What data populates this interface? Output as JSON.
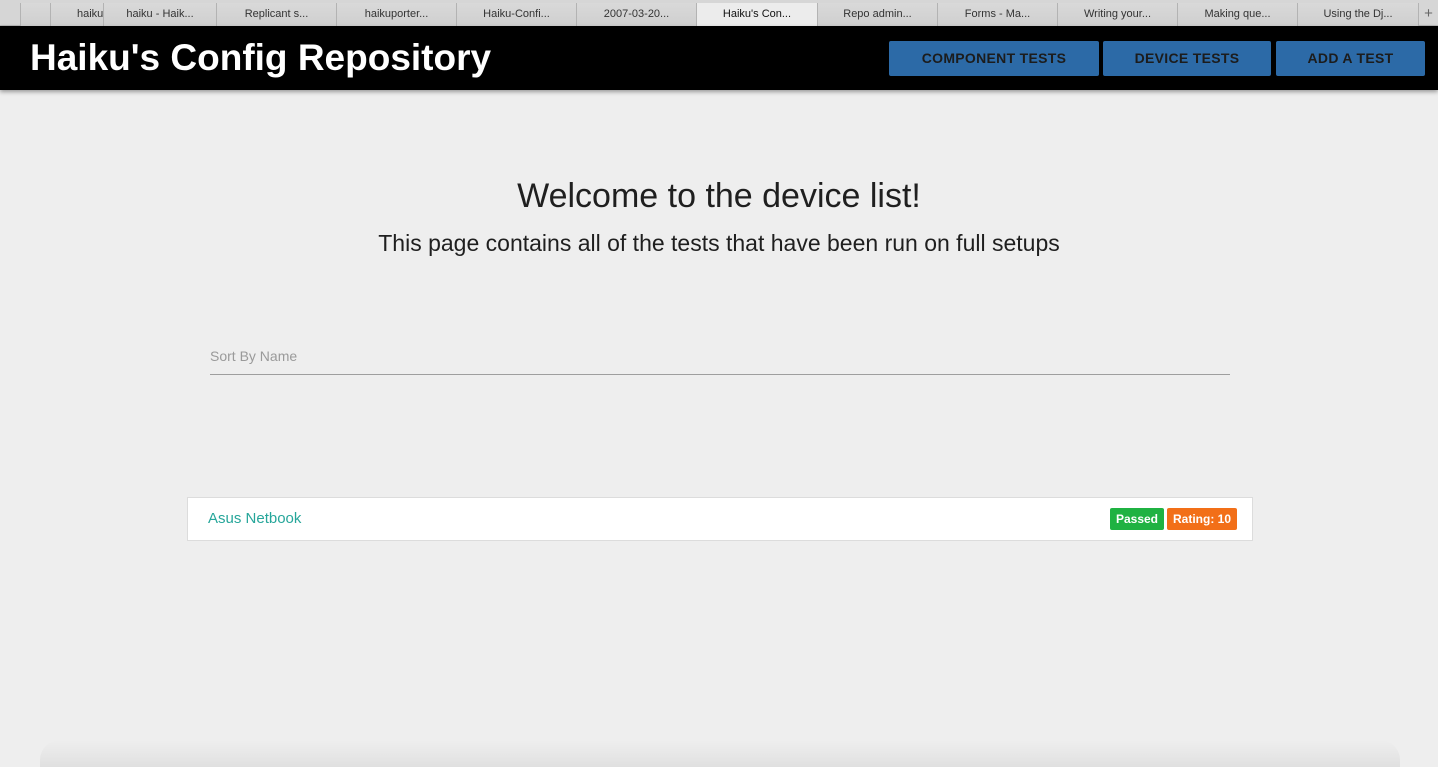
{
  "browser": {
    "tabs": [
      {
        "label": ""
      },
      {
        "label": "haiku"
      },
      {
        "label": "haiku - Haik..."
      },
      {
        "label": "Replicant s..."
      },
      {
        "label": "haikuporter..."
      },
      {
        "label": "Haiku-Confi..."
      },
      {
        "label": "2007-03-20..."
      },
      {
        "label": "Haiku's Con..."
      },
      {
        "label": "Repo admin..."
      },
      {
        "label": "Forms - Ma..."
      },
      {
        "label": "Writing your..."
      },
      {
        "label": "Making que..."
      },
      {
        "label": "Using the Dj..."
      }
    ],
    "active_tab_index": 7,
    "new_tab_label": "+"
  },
  "header": {
    "title": "Haiku's Config Repository",
    "nav": [
      {
        "label": "COMPONENT TESTS"
      },
      {
        "label": "DEVICE TESTS"
      },
      {
        "label": "ADD A TEST"
      }
    ],
    "nav_color": "#2c6aa7",
    "background_color": "#000000"
  },
  "main": {
    "heading": "Welcome to the device list!",
    "subheading": "This page contains all of the tests that have been run on full setups",
    "sort_input": {
      "placeholder": "Sort By Name",
      "value": ""
    },
    "devices": [
      {
        "name": "Asus Netbook",
        "status": "Passed",
        "rating": "Rating: 10",
        "status_color": "#1fb242",
        "rating_color": "#f26f18"
      }
    ]
  }
}
